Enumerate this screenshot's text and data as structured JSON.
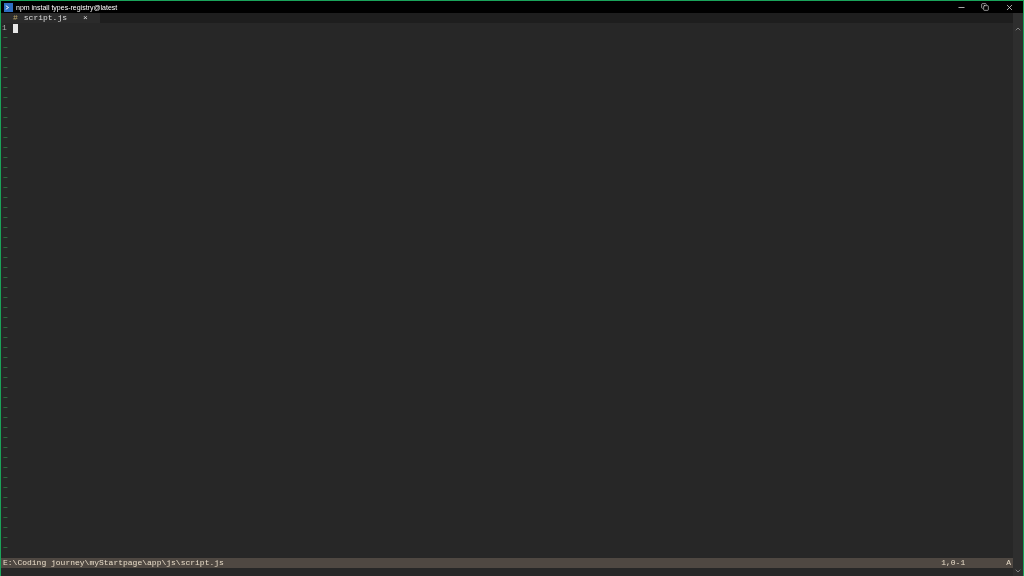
{
  "window": {
    "title": "npm install types-registry@latest"
  },
  "tabs": [
    {
      "label": "script.js",
      "modified_mark": "#",
      "close": "×",
      "selected": true
    }
  ],
  "buffer": {
    "lines": [
      {
        "number": "1"
      }
    ],
    "cursor": true,
    "empty_markers": [
      "~",
      "~",
      "~",
      "~",
      "~",
      "~",
      "~",
      "~",
      "~",
      "~",
      "~",
      "~",
      "~",
      "~",
      "~",
      "~",
      "~",
      "~",
      "~",
      "~",
      "~",
      "~",
      "~",
      "~",
      "~",
      "~",
      "~",
      "~",
      "~",
      "~",
      "~",
      "~",
      "~",
      "~",
      "~",
      "~",
      "~",
      "~",
      "~",
      "~",
      "~",
      "~",
      "~",
      "~",
      "~",
      "~",
      "~",
      "~",
      "~",
      "~",
      "~",
      "~"
    ]
  },
  "status_bar": {
    "path": "E:\\Coding journey\\myStartpage\\app\\js\\script.js",
    "position": "1,0-1",
    "scroll": "A"
  }
}
